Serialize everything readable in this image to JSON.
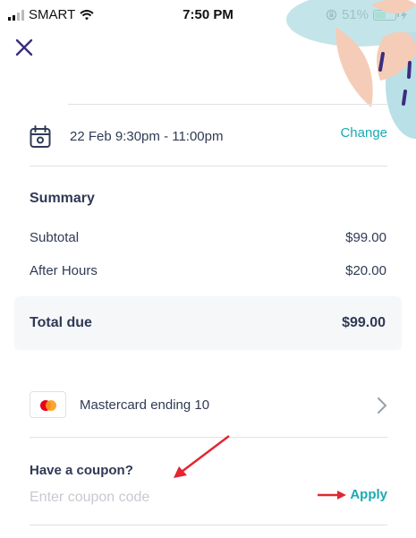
{
  "status_bar": {
    "carrier": "SMART",
    "time": "7:50 PM",
    "battery_percent": "51%",
    "battery_level": 0.51,
    "icons": [
      "signal-bars-icon",
      "wifi-icon",
      "orientation-lock-icon",
      "battery-icon",
      "charging-bolt-icon"
    ]
  },
  "header": {
    "close_icon": "close-x-icon"
  },
  "booking": {
    "calendar_icon": "calendar-icon",
    "datetime": "22 Feb 9:30pm - 11:00pm",
    "change_label": "Change"
  },
  "summary": {
    "title": "Summary",
    "lines": [
      {
        "label": "Subtotal",
        "amount": "$99.00"
      },
      {
        "label": "After Hours",
        "amount": "$20.00"
      }
    ],
    "total_label": "Total due",
    "total_amount": "$99.00"
  },
  "payment": {
    "card_brand_icon": "mastercard-icon",
    "card_label": "Mastercard ending 10",
    "chevron_icon": "chevron-right-icon"
  },
  "coupon": {
    "title": "Have a coupon?",
    "placeholder": "Enter coupon code",
    "value": "",
    "apply_label": "Apply"
  },
  "colors": {
    "text": "#2f3a55",
    "accent": "#1aa9b4",
    "close": "#3b2d7d",
    "annotation_arrows": "#e3262f",
    "total_bg": "#f6f7f9"
  }
}
